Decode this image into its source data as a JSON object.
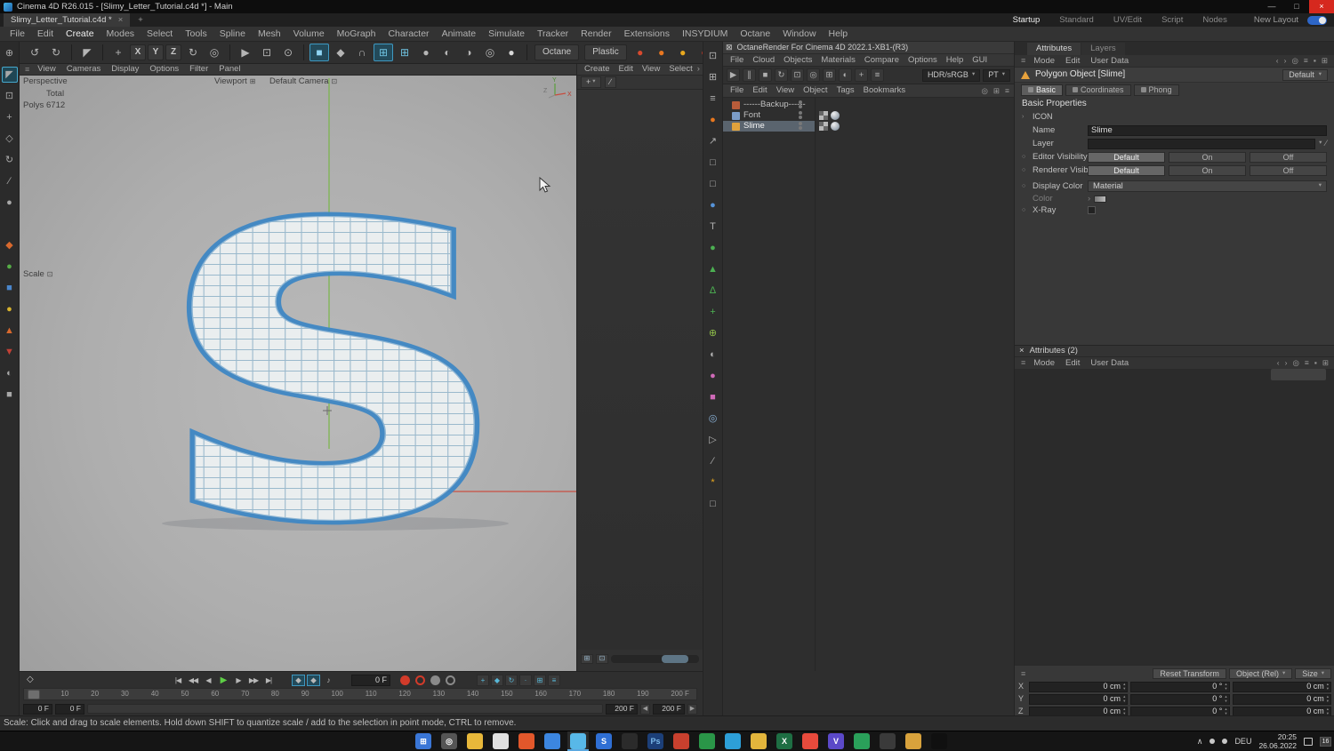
{
  "window": {
    "title": "Cinema 4D R26.015 - [Slimy_Letter_Tutorial.c4d *] - Main",
    "minimize": "—",
    "maximize": "□",
    "close": "×"
  },
  "glyphs": {
    "ham": "≡",
    "caret": "▾",
    "chev": "›",
    "box": "⊞",
    "sbox": "⊡",
    "plus": "+",
    "pipette": "∕",
    "dock": "⊠",
    "search": "◎",
    "spin_up": "▴",
    "spin_down": "▾",
    "chevup": "∧",
    "diamond": "◇"
  },
  "tabbar": {
    "tab": "Slimy_Letter_Tutorial.c4d *",
    "tab_close": "×",
    "add_tab": "+",
    "layouts": [
      {
        "label": "Startup",
        "cls": "on"
      },
      {
        "label": "Standard"
      },
      {
        "label": "UV/Edit"
      },
      {
        "label": "Script"
      },
      {
        "label": "Nodes"
      }
    ],
    "new_layout": "New Layout"
  },
  "menubar": {
    "items": [
      {
        "label": "File"
      },
      {
        "label": "Edit"
      },
      {
        "label": "Create",
        "cls": "hl"
      },
      {
        "label": "Modes"
      },
      {
        "label": "Select"
      },
      {
        "label": "Tools"
      },
      {
        "label": "Spline"
      },
      {
        "label": "Mesh"
      },
      {
        "label": "Volume"
      },
      {
        "label": "MoGraph"
      },
      {
        "label": "Character"
      },
      {
        "label": "Animate"
      },
      {
        "label": "Simulate"
      },
      {
        "label": "Tracker"
      },
      {
        "label": "Render"
      },
      {
        "label": "Extensions"
      },
      {
        "label": "INSYDIUM"
      },
      {
        "label": "Octane"
      },
      {
        "label": "Window"
      },
      {
        "label": "Help"
      }
    ]
  },
  "toolbar": {
    "items": [
      {
        "g": "↺",
        "name": "undo-icon"
      },
      {
        "g": "↻",
        "name": "redo-icon"
      },
      {
        "cls": "sep"
      },
      {
        "g": "◤",
        "name": "live-selection-icon"
      },
      {
        "cls": "sep"
      },
      {
        "g": "+",
        "name": "move-tool-icon"
      },
      {
        "g": "X",
        "cls": "axis",
        "name": "x-lock-button"
      },
      {
        "g": "Y",
        "cls": "axis",
        "name": "y-lock-button"
      },
      {
        "g": "Z",
        "cls": "axis",
        "name": "z-lock-button"
      },
      {
        "g": "↻",
        "name": "rotate-tool-icon"
      },
      {
        "g": "◎",
        "name": "coordinate-system-icon"
      },
      {
        "cls": "sep"
      },
      {
        "g": "▶",
        "name": "render-view-icon"
      },
      {
        "g": "⊡",
        "name": "render-picture-viewer-icon"
      },
      {
        "g": "⊙",
        "name": "render-settings-icon"
      },
      {
        "cls": "sep"
      },
      {
        "g": "■",
        "cls": "on",
        "fg": "#8fd4f2",
        "name": "primitive-cube-icon"
      },
      {
        "g": "◆",
        "name": "spline-pen-icon"
      },
      {
        "g": "∩",
        "name": "deformer-icon"
      },
      {
        "g": "⊞",
        "cls": "on",
        "fg": "#6fc2e0",
        "name": "mograph-cloner-icon"
      },
      {
        "g": "⊞",
        "fg": "#6fc2e0",
        "name": "mograph-grid-icon"
      },
      {
        "g": "●",
        "name": "field-sphere-icon"
      },
      {
        "g": "◐",
        "name": "volume-builder-icon"
      },
      {
        "g": "◑",
        "name": "material-ball-icon"
      },
      {
        "g": "◎",
        "name": "sky-object-icon"
      },
      {
        "g": "●",
        "fg": "#d8d8d8",
        "name": "light-object-icon"
      },
      {
        "cls": "sep"
      },
      {
        "g": "Octane",
        "cls": "lbl",
        "name": "octane-menu-button"
      },
      {
        "g": "Plastic",
        "cls": "lbl",
        "name": "plastic-menu-button"
      },
      {
        "g": "●",
        "fg": "#d84a2e",
        "name": "octane-material-icon"
      },
      {
        "g": "●",
        "fg": "#e87720",
        "name": "octane-logo-icon"
      },
      {
        "g": "●",
        "fg": "#e8a81e",
        "name": "octane-sun-icon"
      },
      {
        "g": "●",
        "fg": "#c23a2a",
        "name": "octane-render-icon"
      },
      {
        "g": "■",
        "fg": "#555555",
        "name": "extra-tool-icon"
      }
    ]
  },
  "left_strip": {
    "items": [
      {
        "g": "⊕",
        "name": "zoom-icon"
      },
      {
        "g": "◤",
        "cls": "active",
        "name": "selection-tool-icon"
      },
      {
        "g": "⊡",
        "name": "frame-selection-icon"
      },
      {
        "g": "+",
        "name": "move-icon"
      },
      {
        "g": "◇",
        "name": "scale-icon"
      },
      {
        "g": "↻",
        "name": "rotate-icon"
      },
      {
        "g": "∕",
        "name": "knife-icon"
      },
      {
        "g": "●",
        "name": "brush-icon"
      },
      {
        "g": "◆",
        "cls": "gap",
        "fg": "#d8692e",
        "name": "model-mode-icon"
      },
      {
        "g": "●",
        "fg": "#56ad46",
        "name": "object-mode-icon"
      },
      {
        "g": "■",
        "fg": "#4a86cc",
        "name": "workplane-mode-icon"
      },
      {
        "g": "●",
        "fg": "#d8b32e",
        "name": "points-mode-icon"
      },
      {
        "g": "▲",
        "fg": "#d8692e",
        "name": "edges-mode-icon"
      },
      {
        "g": "▼",
        "fg": "#c24136",
        "name": "polygons-mode-icon"
      },
      {
        "g": "◐",
        "name": "texture-mode-icon"
      },
      {
        "g": "■",
        "name": "axis-mode-icon"
      }
    ]
  },
  "viewport": {
    "menus": [
      "View",
      "Cameras",
      "Display",
      "Options",
      "Filter",
      "Panel"
    ],
    "label": "Perspective",
    "viewport_tag": "Viewport",
    "camera_tag": "Default Camera",
    "total_label": "Total",
    "polys_label": "Polys",
    "polys_value": "6712",
    "scale_label": "Scale",
    "letter": "S",
    "axis_y": "Y",
    "axis_z": "Z",
    "axis_x": "X"
  },
  "mid": {
    "menus": [
      "Create",
      "Edit",
      "View",
      "Select"
    ],
    "overflow": "›"
  },
  "octane_strip": {
    "items": [
      {
        "g": "⊡",
        "name": "live-viewer-icon"
      },
      {
        "g": "⊞",
        "name": "octane-dock-icon"
      },
      {
        "g": "≡",
        "name": "octane-settings-icon"
      },
      {
        "g": "●",
        "fg": "#e8771e",
        "name": "octane-logo-icon"
      },
      {
        "g": "↗",
        "name": "kernel-graph-icon"
      },
      {
        "g": "□",
        "name": "render-region-icon"
      },
      {
        "g": "□",
        "name": "film-region-icon"
      },
      {
        "g": "●",
        "fg": "#5693d8",
        "name": "octane-object-icon"
      },
      {
        "g": "T",
        "name": "octane-text-icon"
      },
      {
        "g": "●",
        "fg": "#4cb052",
        "name": "octane-light-icon"
      },
      {
        "g": "▲",
        "fg": "#4cb052",
        "name": "area-light-icon"
      },
      {
        "g": "∆",
        "fg": "#4cb052",
        "name": "target-light-icon"
      },
      {
        "g": "+",
        "fg": "#4cb052",
        "name": "ies-light-icon"
      },
      {
        "g": "⊕",
        "fg": "#8fbf4a",
        "name": "daylight-icon"
      },
      {
        "g": "◐",
        "name": "hdri-environment-icon"
      },
      {
        "g": "●",
        "fg": "#cf6ab8",
        "name": "scatter-icon"
      },
      {
        "g": "■",
        "fg": "#cf6ab8",
        "name": "vdb-volume-icon"
      },
      {
        "g": "◎",
        "fg": "#8ab2d8",
        "name": "octane-camera-icon"
      },
      {
        "g": "▷",
        "name": "render-passes-icon"
      },
      {
        "g": "∕",
        "name": "paint-icon"
      },
      {
        "g": "*",
        "fg": "#e8a81e",
        "name": "livedb-icon"
      },
      {
        "g": "□",
        "name": "crop-icon"
      }
    ]
  },
  "octane_lv": {
    "title": "OctaneRender For Cinema 4D 2022.1-XB1-(R3)",
    "menus": [
      "File",
      "Cloud",
      "Objects",
      "Materials",
      "Compare",
      "Options",
      "Help",
      "GUI"
    ],
    "tools": [
      {
        "g": "▶",
        "name": "lv-play-icon"
      },
      {
        "g": "∥",
        "name": "lv-pause-icon"
      },
      {
        "g": "■",
        "name": "lv-stop-icon"
      },
      {
        "g": "↻",
        "name": "lv-restart-icon"
      },
      {
        "g": "⊡",
        "name": "lv-region-icon"
      },
      {
        "g": "◎",
        "name": "lv-focus-picker-icon"
      },
      {
        "g": "⊞",
        "name": "lv-subsample-icon"
      },
      {
        "g": "◐",
        "name": "lv-clay-mode-icon"
      },
      {
        "g": "+",
        "name": "lv-add-icon"
      },
      {
        "g": "≡",
        "name": "lv-menu-icon"
      }
    ],
    "colorspace": "HDR/sRGB",
    "kernel": "PT"
  },
  "om": {
    "menus": [
      "File",
      "Edit",
      "View",
      "Object",
      "Tags",
      "Bookmarks"
    ],
    "right_icons": [
      {
        "g": "◎",
        "name": "om-search-icon"
      },
      {
        "g": "⊞",
        "name": "om-view-icon"
      },
      {
        "g": "≡",
        "name": "om-filter-icon"
      }
    ],
    "objects": [
      {
        "name": "------Backup------",
        "c": "#b85c3a",
        "cls": "notags"
      },
      {
        "name": "Font",
        "c": "#7a9cc8"
      },
      {
        "name": "Slime",
        "c": "#e0a23c",
        "cls": "selected"
      }
    ]
  },
  "attr": {
    "tab_attributes": "Attributes",
    "tab_layers": "Layers",
    "menus": [
      "Mode",
      "Edit",
      "User Data"
    ],
    "right_icons": [
      {
        "g": "‹",
        "name": "attr-back-icon"
      },
      {
        "g": "›",
        "name": "attr-forward-icon"
      },
      {
        "g": "◎",
        "name": "attr-search-icon"
      },
      {
        "g": "≡",
        "name": "attr-filter-icon"
      },
      {
        "g": "▪",
        "name": "attr-lock-icon"
      },
      {
        "g": "⊞",
        "name": "attr-newwin-icon"
      }
    ],
    "object_title": "Polygon Object [Slime]",
    "preset": "Default",
    "tabs": [
      {
        "label": "Basic",
        "cls": "on"
      },
      {
        "label": "Coordinates"
      },
      {
        "label": "Phong"
      }
    ],
    "section": "Basic Properties",
    "icon_row": "ICON",
    "name_label": "Name",
    "name_value": "Slime",
    "layer_label": "Layer",
    "editor_visibility": "Editor Visibility",
    "renderer_visibility": "Renderer Visibility",
    "visibility_options": [
      "Default",
      "On",
      "Off"
    ],
    "display_color_label": "Display Color",
    "display_color_value": "Material",
    "color_label": "Color",
    "xray_label": "X-Ray"
  },
  "attr2": {
    "close": "×",
    "title": "Attributes (2)"
  },
  "coords": {
    "reset": "Reset Transform",
    "mode": "Object (Rel)",
    "size": "Size",
    "rows": [
      {
        "axis": "X",
        "pos": "0 cm",
        "rot": "0 °",
        "scl": "0 cm"
      },
      {
        "axis": "Y",
        "pos": "0 cm",
        "rot": "0 °",
        "scl": "0 cm"
      },
      {
        "axis": "Z",
        "pos": "0 cm",
        "rot": "0 °",
        "scl": "0 cm"
      }
    ]
  },
  "timeline": {
    "transport": [
      {
        "g": "|◀",
        "name": "goto-start-button"
      },
      {
        "g": "◀◀",
        "name": "prev-key-button"
      },
      {
        "g": "◀",
        "name": "prev-frame-button"
      },
      {
        "g": "▶",
        "cls": "play",
        "name": "play-button"
      },
      {
        "g": "▶",
        "name": "next-frame-button"
      },
      {
        "g": "▶▶",
        "name": "next-key-button"
      },
      {
        "g": "▶|",
        "name": "goto-end-button"
      }
    ],
    "toggles": [
      {
        "g": "◆",
        "cls": "on",
        "name": "keyframe-mode-button"
      },
      {
        "g": "◆",
        "cls": "on",
        "name": "autokey-mode-button"
      },
      {
        "g": "♪",
        "name": "sound-button"
      }
    ],
    "current_frame": "0 F",
    "records": [
      {
        "cls": "dot",
        "fg": "#d23b2a",
        "name": "record-keyframe-button"
      },
      {
        "cls": "ring",
        "fg": "#d23b2a",
        "name": "autokey-button"
      },
      {
        "cls": "dot",
        "fg": "#8a8a8a",
        "name": "keyframe-selection-button"
      },
      {
        "cls": "ring",
        "fg": "#8a8a8a",
        "name": "keyframe-clock-button"
      }
    ],
    "params": [
      {
        "g": "+",
        "name": "record-position-toggle"
      },
      {
        "g": "◆",
        "name": "record-scale-toggle"
      },
      {
        "g": "↻",
        "name": "record-rotation-toggle"
      },
      {
        "g": "·",
        "name": "record-pla-toggle"
      },
      {
        "g": "⊞",
        "name": "record-params-toggle"
      },
      {
        "g": "≡",
        "name": "record-filter-toggle"
      }
    ],
    "ticks": [
      "0",
      "10",
      "20",
      "30",
      "40",
      "50",
      "60",
      "70",
      "80",
      "90",
      "100",
      "110",
      "120",
      "130",
      "140",
      "150",
      "160",
      "170",
      "180",
      "190",
      "200 F"
    ],
    "range_start_1": "0 F",
    "range_start_2": "0 F",
    "range_end_1": "200 F",
    "range_end_2": "200 F",
    "arrow_left": "◀",
    "arrow_right": "▶"
  },
  "status": {
    "text": "Scale: Click and drag to scale elements. Hold down SHIFT to quantize scale / add to the selection in point mode, CTRL to remove."
  },
  "taskbar": {
    "icons": [
      {
        "c": "#3a76d6",
        "g": "⊞",
        "name": "start-button"
      },
      {
        "c": "#555555",
        "g": "◎",
        "name": "search-icon"
      },
      {
        "c": "#e8b83a",
        "name": "file-explorer-icon"
      },
      {
        "c": "#e0e0e0",
        "name": "light-app-icon"
      },
      {
        "c": "#e2572b",
        "name": "firefox-icon"
      },
      {
        "c": "#3c86e0",
        "name": "edge-icon"
      },
      {
        "c": "#58b8e8",
        "cls": "active",
        "name": "cinema4d-icon"
      },
      {
        "c": "#2f6fd4",
        "g": "S",
        "name": "s-app-icon"
      },
      {
        "c": "#2b2b2b",
        "name": "dark-app-icon"
      },
      {
        "c": "#1c3f78",
        "g": "Ps",
        "fg": "#7ab8e8",
        "name": "photoshop-icon"
      },
      {
        "c": "#c8402e",
        "name": "red-app-icon"
      },
      {
        "c": "#2a9648",
        "name": "green-app-icon"
      },
      {
        "c": "#2d9fd8",
        "name": "blue-app-icon"
      },
      {
        "c": "#e3b53c",
        "name": "yellow-app-icon"
      },
      {
        "c": "#1e6e43",
        "g": "X",
        "name": "excel-icon"
      },
      {
        "c": "#e84a3c",
        "name": "chrome-icon"
      },
      {
        "c": "#5b49c8",
        "g": "V",
        "name": "v-app-icon"
      },
      {
        "c": "#2aa05a",
        "name": "green-app2-icon"
      },
      {
        "c": "#3a3a3a",
        "name": "gray-app-icon"
      },
      {
        "c": "#d8a23c",
        "name": "folder-app-icon"
      },
      {
        "c": "#101010",
        "name": "terminal-icon"
      }
    ],
    "tray_chevron": "∧",
    "lang": "DEU",
    "time": "20:25",
    "date": "26.06.2022",
    "badge": "16"
  }
}
